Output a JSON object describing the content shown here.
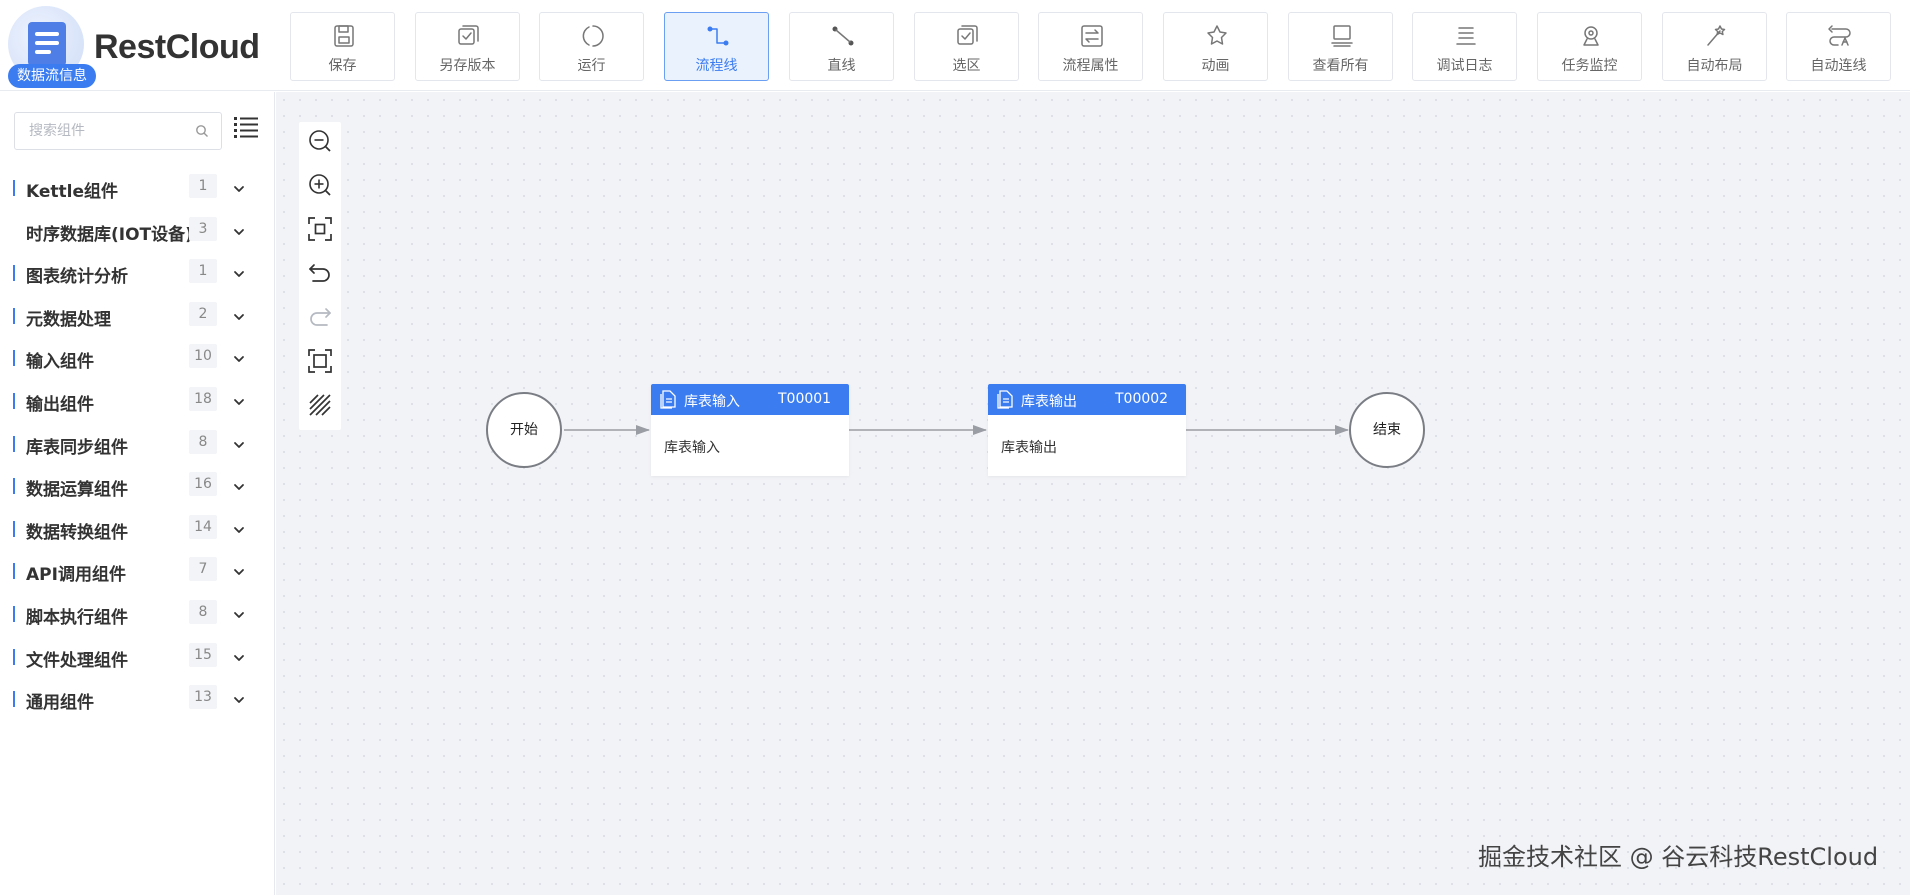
{
  "app": {
    "logo_text": "RestCloud",
    "badge": "数据流信息"
  },
  "toolbar": [
    {
      "label": "保存",
      "icon": "save-icon",
      "active": false
    },
    {
      "label": "另存版本",
      "icon": "save-version-icon",
      "active": false
    },
    {
      "label": "运行",
      "icon": "run-icon",
      "active": false
    },
    {
      "label": "流程线",
      "icon": "flow-line-icon",
      "active": true
    },
    {
      "label": "直线",
      "icon": "straight-line-icon",
      "active": false
    },
    {
      "label": "选区",
      "icon": "select-area-icon",
      "active": false
    },
    {
      "label": "流程属性",
      "icon": "flow-properties-icon",
      "active": false
    },
    {
      "label": "动画",
      "icon": "animation-icon",
      "active": false
    },
    {
      "label": "查看所有",
      "icon": "view-all-icon",
      "active": false
    },
    {
      "label": "调试日志",
      "icon": "debug-log-icon",
      "active": false
    },
    {
      "label": "任务监控",
      "icon": "task-monitor-icon",
      "active": false
    },
    {
      "label": "自动布局",
      "icon": "auto-layout-icon",
      "active": false
    },
    {
      "label": "自动连线",
      "icon": "auto-connect-icon",
      "active": false
    }
  ],
  "sidebar": {
    "search_placeholder": "搜索组件",
    "categories": [
      {
        "name": "Kettle组件",
        "count": "1",
        "bar": true
      },
      {
        "name": "时序数据库(IOT设备)",
        "count": "3",
        "bar": false
      },
      {
        "name": "图表统计分析",
        "count": "1",
        "bar": true
      },
      {
        "name": "元数据处理",
        "count": "2",
        "bar": true
      },
      {
        "name": "输入组件",
        "count": "10",
        "bar": true
      },
      {
        "name": "输出组件",
        "count": "18",
        "bar": true
      },
      {
        "name": "库表同步组件",
        "count": "8",
        "bar": true
      },
      {
        "name": "数据运算组件",
        "count": "16",
        "bar": true
      },
      {
        "name": "数据转换组件",
        "count": "14",
        "bar": true
      },
      {
        "name": "API调用组件",
        "count": "7",
        "bar": true
      },
      {
        "name": "脚本执行组件",
        "count": "8",
        "bar": true
      },
      {
        "name": "文件处理组件",
        "count": "15",
        "bar": true
      },
      {
        "name": "通用组件",
        "count": "13",
        "bar": true
      }
    ]
  },
  "canvas": {
    "start_label": "开始",
    "end_label": "结束",
    "tasks": [
      {
        "title": "库表输入",
        "id": "T00001",
        "body": "库表输入"
      },
      {
        "title": "库表输出",
        "id": "T00002",
        "body": "库表输出"
      }
    ],
    "zoom_tools": [
      "zoom-out-icon",
      "zoom-in-icon",
      "fit-view-icon",
      "undo-icon",
      "redo-icon",
      "actual-size-icon",
      "grid-toggle-icon"
    ]
  },
  "watermark": "掘金技术社区 @ 谷云科技RestCloud",
  "colors": {
    "accent": "#3b7cf0",
    "canvas_bg": "#f2f3f7",
    "active_btn_bg": "#eaf2fe"
  }
}
